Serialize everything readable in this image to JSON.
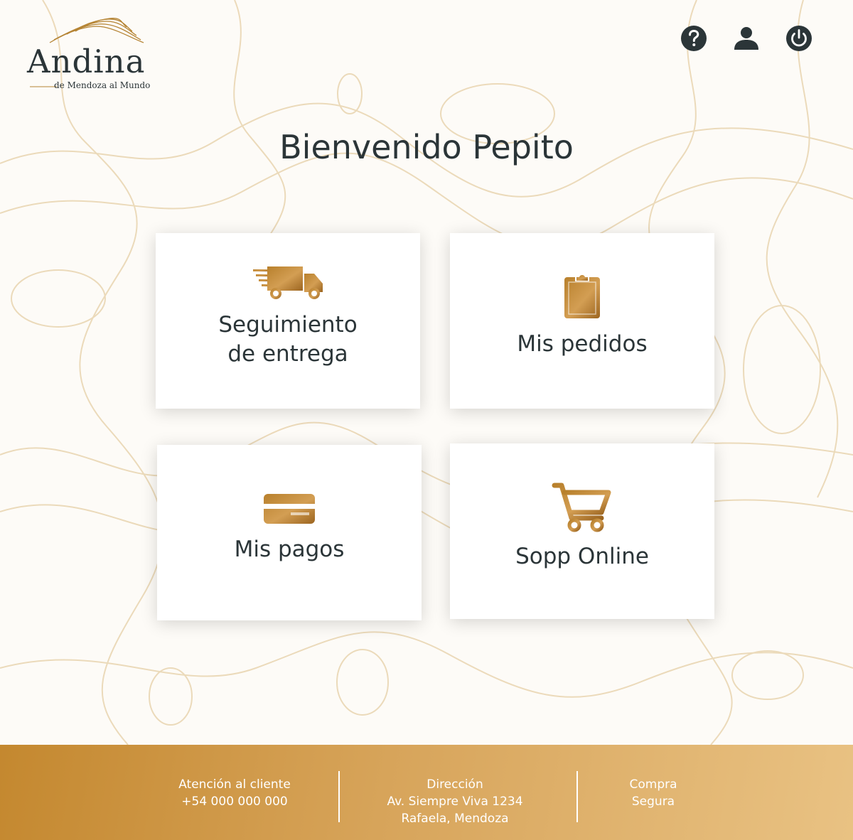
{
  "brand": {
    "name": "Andina",
    "tagline": "de Mendoza al Mundo",
    "gold": "#c4882f",
    "dark": "#2b3538"
  },
  "header": {
    "icons": [
      "help-icon",
      "user-icon",
      "power-icon"
    ]
  },
  "welcome": "Bienvenido Pepito",
  "cards": [
    {
      "label": "Seguimiento\nde entrega",
      "icon": "truck-icon"
    },
    {
      "label": "Mis pedidos",
      "icon": "clipboard-icon"
    },
    {
      "label": "Mis pagos",
      "icon": "credit-card-icon"
    },
    {
      "label": "Sopp Online",
      "icon": "cart-icon"
    }
  ],
  "footer": {
    "customer": {
      "title": "Atención al cliente",
      "phone": "+54 000 000 000"
    },
    "address": {
      "title": "Dirección",
      "line1": "Av. Siempre Viva 1234",
      "line2": "Rafaela, Mendoza"
    },
    "secure": {
      "line1": "Compra",
      "line2": "Segura"
    }
  }
}
